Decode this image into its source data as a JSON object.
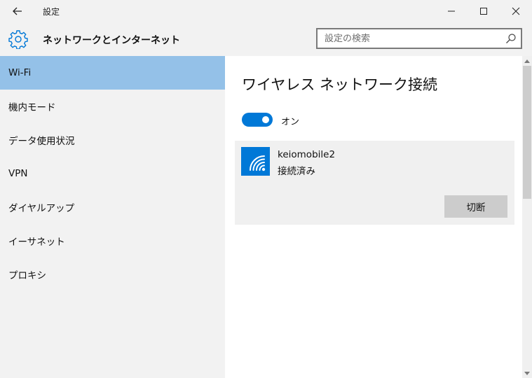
{
  "window": {
    "title": "設定",
    "controls": [
      "minimize-icon",
      "maximize-icon",
      "close-icon"
    ]
  },
  "header": {
    "icon": "gear-icon",
    "title": "ネットワークとインターネット"
  },
  "search": {
    "placeholder": "設定の検索",
    "value": "",
    "icon": "search-icon"
  },
  "sidebar": {
    "items": [
      {
        "label": "Wi-Fi",
        "selected": true
      },
      {
        "label": "機内モード",
        "selected": false
      },
      {
        "label": "データ使用状況",
        "selected": false
      },
      {
        "label": "VPN",
        "selected": false
      },
      {
        "label": "ダイヤルアップ",
        "selected": false
      },
      {
        "label": "イーサネット",
        "selected": false
      },
      {
        "label": "プロキシ",
        "selected": false
      }
    ]
  },
  "main": {
    "section_title": "ワイヤレス ネットワーク接続",
    "toggle": {
      "state": "on",
      "label": "オン"
    },
    "network": {
      "icon": "wifi-icon",
      "name": "keiomobile2",
      "status": "接続済み",
      "button_label": "切断"
    }
  },
  "colors": {
    "accent": "#0078d7",
    "selected_nav": "#94c1e8",
    "sidebar_bg": "#f2f2f2",
    "content_bg": "#ffffff",
    "card_bg": "#f0f0f0",
    "button_bg": "#cccccc"
  }
}
